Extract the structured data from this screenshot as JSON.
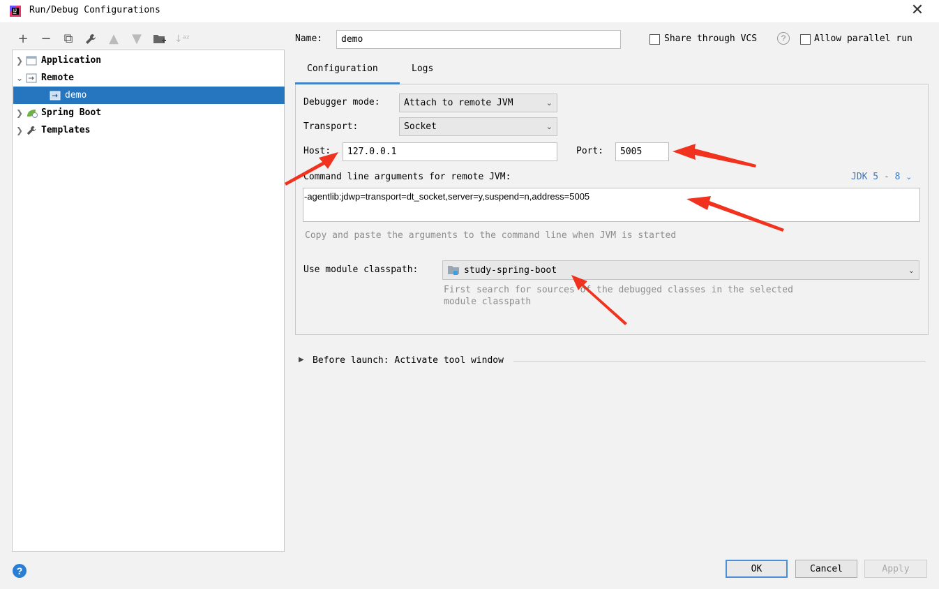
{
  "window": {
    "title": "Run/Debug Configurations"
  },
  "toolbar": {
    "icons": [
      "add-icon",
      "remove-icon",
      "copy-icon",
      "wrench-icon",
      "move-up-icon",
      "move-down-icon",
      "folder-add-icon",
      "sort-icon"
    ]
  },
  "tree": {
    "items": [
      {
        "label": "Application",
        "expanded": false
      },
      {
        "label": "Remote",
        "expanded": true
      },
      {
        "label": "demo",
        "selected": true
      },
      {
        "label": "Spring Boot",
        "expanded": false
      },
      {
        "label": "Templates",
        "expanded": false
      }
    ]
  },
  "name_field": {
    "label": "Name:",
    "value": "demo"
  },
  "share_vcs": {
    "label": "Share through VCS",
    "checked": false
  },
  "allow_parallel": {
    "label": "Allow parallel run",
    "checked": false
  },
  "tabs": [
    {
      "label": "Configuration",
      "active": true
    },
    {
      "label": "Logs",
      "active": false
    }
  ],
  "config": {
    "debugger_mode": {
      "label": "Debugger mode:",
      "value": "Attach to remote JVM"
    },
    "transport": {
      "label": "Transport:",
      "value": "Socket"
    },
    "host": {
      "label": "Host:",
      "value": "127.0.0.1"
    },
    "port": {
      "label": "Port:",
      "value": "5005"
    },
    "cmd_args": {
      "label": "Command line arguments for remote JVM:",
      "jdk_selector": "JDK 5 - 8",
      "value": "-agentlib:jdwp=transport=dt_socket,server=y,suspend=n,address=5005",
      "hint": "Copy and paste the arguments to the command line when JVM is started"
    },
    "module_classpath": {
      "label": "Use module classpath:",
      "value": "study-spring-boot",
      "hint_line1": "First search for sources of the debugged classes in the selected",
      "hint_line2": "module classpath"
    }
  },
  "before_launch": {
    "label": "Before launch: Activate tool window"
  },
  "buttons": {
    "ok": "OK",
    "cancel": "Cancel",
    "apply": "Apply"
  },
  "colors": {
    "selection": "#2675bf",
    "accent": "#4083c9",
    "annotation_arrow": "#f0321e"
  }
}
